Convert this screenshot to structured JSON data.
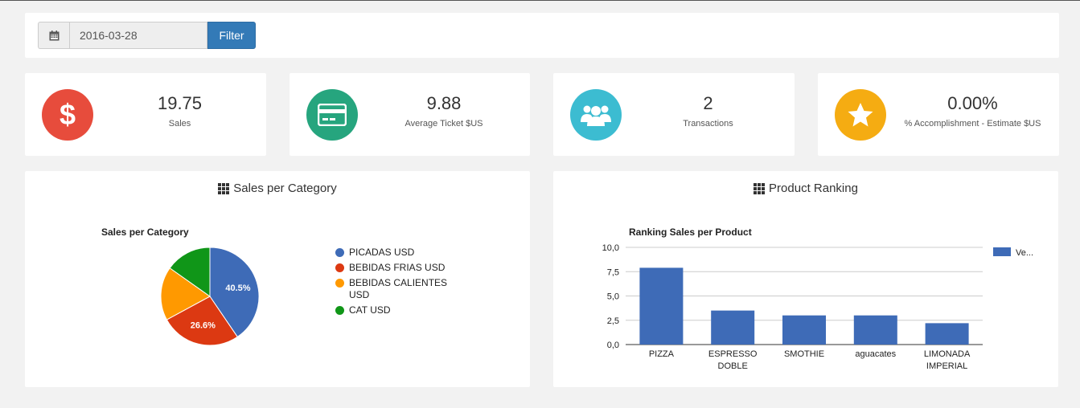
{
  "filter": {
    "date_value": "2016-03-28",
    "button_label": "Filter"
  },
  "stats": [
    {
      "value": "19.75",
      "label": "Sales",
      "color": "#e74c3c",
      "icon": "dollar-icon"
    },
    {
      "value": "9.88",
      "label": "Average Ticket $US",
      "color": "#26a57e",
      "icon": "credit-card-icon"
    },
    {
      "value": "2",
      "label": "Transactions",
      "color": "#3cbcd1",
      "icon": "users-icon"
    },
    {
      "value": "0.00%",
      "label": "% Accomplishment - Estimate $US",
      "color": "#f5ac12",
      "icon": "star-icon"
    }
  ],
  "category_panel": {
    "heading": "Sales per Category",
    "chart_title": "Sales per Category",
    "legend": [
      {
        "label": "PICADAS USD",
        "color": "#3e6bb7"
      },
      {
        "label": "BEBIDAS FRIAS USD",
        "color": "#dc3912"
      },
      {
        "label": "BEBIDAS CALIENTES USD",
        "color": "#ff9900"
      },
      {
        "label": "CAT USD",
        "color": "#109618"
      }
    ]
  },
  "ranking_panel": {
    "heading": "Product Ranking",
    "chart_title": "Ranking Sales per Product",
    "legend_label": "Ve..."
  },
  "chart_data": [
    {
      "type": "pie",
      "title": "Sales per Category",
      "categories": [
        "PICADAS USD",
        "BEBIDAS FRIAS USD",
        "BEBIDAS CALIENTES USD",
        "CAT USD"
      ],
      "values": [
        40.5,
        26.6,
        17.7,
        15.2
      ],
      "labels": [
        "40.5%",
        "26.6%",
        "",
        ""
      ],
      "colors": [
        "#3e6bb7",
        "#dc3912",
        "#ff9900",
        "#109618"
      ],
      "legend": "right"
    },
    {
      "type": "bar",
      "title": "Ranking Sales per Product",
      "categories": [
        "PIZZA",
        "ESPRESSO DOBLE",
        "SMOTHIE",
        "aguacates",
        "LIMONADA IMPERIAL"
      ],
      "category_lines": [
        [
          "PIZZA"
        ],
        [
          "ESPRESSO",
          "DOBLE"
        ],
        [
          "SMOTHIE"
        ],
        [
          "aguacates"
        ],
        [
          "LIMONADA",
          "IMPERIAL"
        ]
      ],
      "series": [
        {
          "name": "Ve...",
          "values": [
            7.9,
            3.5,
            3.0,
            3.0,
            2.2
          ]
        }
      ],
      "ylim": [
        0,
        10
      ],
      "yticks": [
        "0,0",
        "2,5",
        "5,0",
        "7,5",
        "10,0"
      ],
      "color": "#3e6bb7",
      "grid": true,
      "legend": "right"
    }
  ]
}
